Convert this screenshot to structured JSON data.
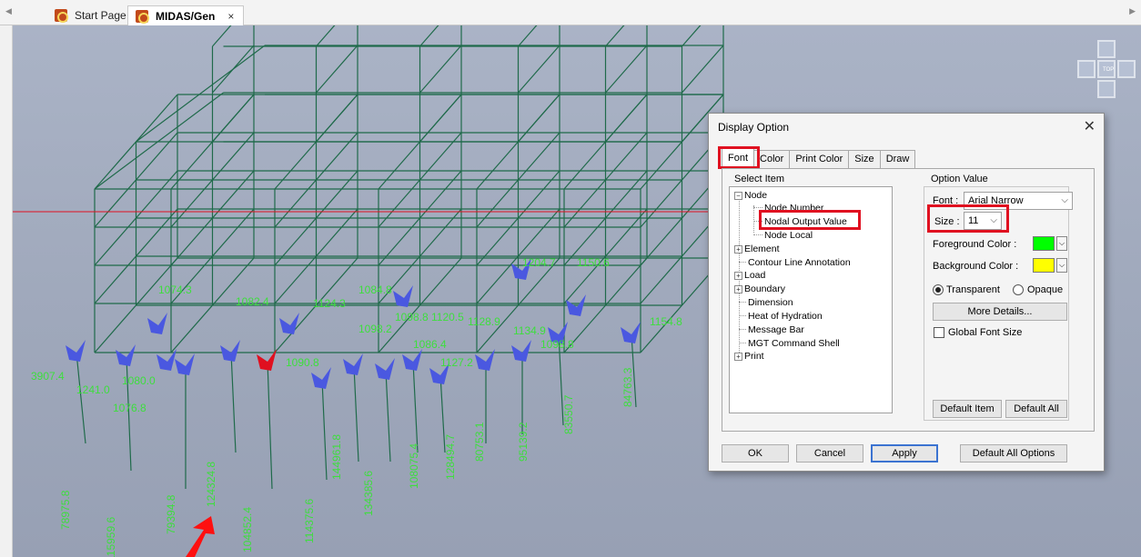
{
  "tabs": {
    "start_page": "Start Page",
    "midas_gen": "MIDAS/Gen",
    "close_glyph": "×"
  },
  "view_cube": {
    "top_label": "TOP"
  },
  "model_labels": [
    "3907.4",
    "1241.0",
    "1080.0",
    "1074.3",
    "1082.4",
    "1124.3",
    "1084.8",
    "1098.8",
    "1120.5",
    "1128.9",
    "1134.9",
    "1204.7",
    "1150.6",
    "1154.8",
    "1090.8",
    "1098.2",
    "1086.4",
    "1127.2",
    "1076.8",
    "1098.8",
    "78975.8",
    "115959.6",
    "79394.8",
    "124324.8",
    "104852.4",
    "114375.6",
    "144961.8",
    "134385.6",
    "108075.4",
    "128494.7",
    "80753.1",
    "95139.2",
    "83550.7",
    "84763.3"
  ],
  "dialog": {
    "title": "Display Option",
    "close_glyph": "✕",
    "tabs": [
      "Font",
      "Color",
      "Print Color",
      "Size",
      "Draw"
    ],
    "select_item_label": "Select Item",
    "option_value_label": "Option Value",
    "tree": {
      "node": "Node",
      "node_number": "Node Number",
      "nodal_output_value": "Nodal Output Value",
      "node_local": "Node Local",
      "element": "Element",
      "contour_line_annotation": "Contour Line Annotation",
      "load": "Load",
      "boundary": "Boundary",
      "dimension": "Dimension",
      "heat_of_hydration": "Heat of Hydration",
      "message_bar": "Message Bar",
      "mgt_command_shell": "MGT Command Shell",
      "print": "Print"
    },
    "font_label": "Font :",
    "font_value": "Arial Narrow",
    "size_label": "Size :",
    "size_value": "11",
    "foreground_label": "Foreground Color :",
    "foreground_color": "#00ff00",
    "background_label": "Background Color :",
    "background_color": "#ffff00",
    "transparent_label": "Transparent",
    "opaque_label": "Opaque",
    "more_details": "More Details...",
    "global_font_size": "Global Font Size",
    "default_item": "Default Item",
    "default_all": "Default All",
    "ok": "OK",
    "cancel": "Cancel",
    "apply": "Apply",
    "default_all_options": "Default All Options"
  },
  "colors": {
    "frame": "#1f6a4a",
    "label": "#3dde3d",
    "arrow": "#4a58e0",
    "highlight": "#e01020"
  }
}
